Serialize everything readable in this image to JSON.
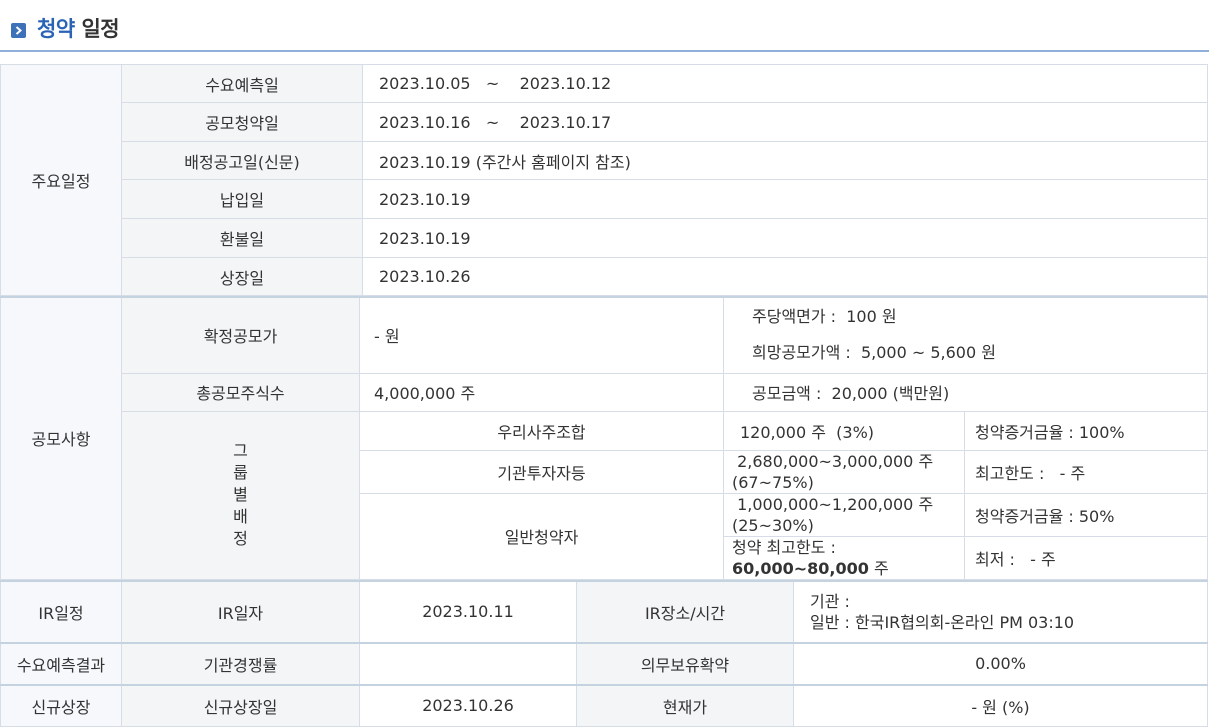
{
  "header": {
    "title_accent": "청약",
    "title_rest": " 일정",
    "icon": "arrow-right-box-icon"
  },
  "main_schedule": {
    "section": "주요일정",
    "rows": [
      {
        "label": "수요예측일",
        "value": "2023.10.05   ~    2023.10.12"
      },
      {
        "label": "공모청약일",
        "value": "2023.10.16   ~    2023.10.17"
      },
      {
        "label": "배정공고일(신문)",
        "value": "2023.10.19 (주간사 홈페이지 참조)"
      },
      {
        "label": "납입일",
        "value": "2023.10.19"
      },
      {
        "label": "환불일",
        "value": "2023.10.19"
      },
      {
        "label": "상장일",
        "value": "2023.10.26"
      }
    ]
  },
  "offering": {
    "section": "공모사항",
    "final_price_label": "확정공모가",
    "final_price_value": "- 원",
    "par_value": "주당액면가 :  100 원",
    "desired_price": "희망공모가액 :  5,000 ~ 5,600 원",
    "total_shares_label": "총공모주식수",
    "total_shares_value": "4,000,000 주",
    "offering_amount": "공모금액 :  20,000 (백만원)",
    "group_label": [
      "그",
      "룹",
      "별",
      "배",
      "정"
    ],
    "groups": [
      {
        "name": "우리사주조합",
        "shares": "120,000 주  (3%)",
        "note": "청약증거금율 : 100%"
      },
      {
        "name": "기관투자자등",
        "shares_line1": " 2,680,000~3,000,000 주",
        "shares_line2": "(67~75%)",
        "note": "최고한도 :   - 주"
      },
      {
        "name": "일반청약자",
        "shares_line1": " 1,000,000~1,200,000 주",
        "shares_line2": "(25~30%)",
        "note": "청약증거금율 : 50%",
        "limit_line1": "청약 최고한도 :",
        "limit_bold": "60,000~80,000",
        "limit_unit": " 주",
        "min": "최저 :   - 주"
      }
    ]
  },
  "ir": {
    "section": "IR일정",
    "date_label": "IR일자",
    "date_value": "2023.10.11",
    "place_label": "IR장소/시간",
    "place_line1": "기관 :",
    "place_line2": "일반 : 한국IR협의회-온라인 PM 03:10"
  },
  "demand": {
    "section": "수요예측결과",
    "competition_label": "기관경쟁률",
    "competition_value": "",
    "lockup_label": "의무보유확약",
    "lockup_value": "0.00%"
  },
  "listing": {
    "section": "신규상장",
    "date_label": "신규상장일",
    "date_value": "2023.10.26",
    "price_label": "현재가",
    "price_value": "- 원 (%)"
  }
}
